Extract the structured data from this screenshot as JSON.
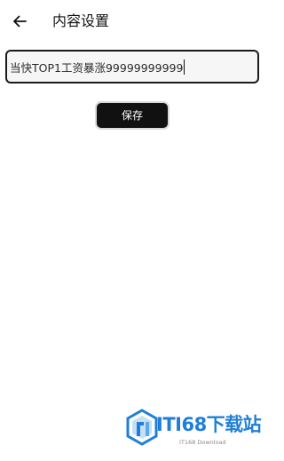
{
  "header": {
    "title": "内容设置",
    "back_icon": "arrow-left-icon"
  },
  "content_input": {
    "value": "当快TOP1工资暴涨99999999999"
  },
  "save_button": {
    "label": "保存"
  },
  "watermark": {
    "brand": "ITI68下载站",
    "sub": "IT168 Download",
    "color": "#1f7fd8"
  }
}
